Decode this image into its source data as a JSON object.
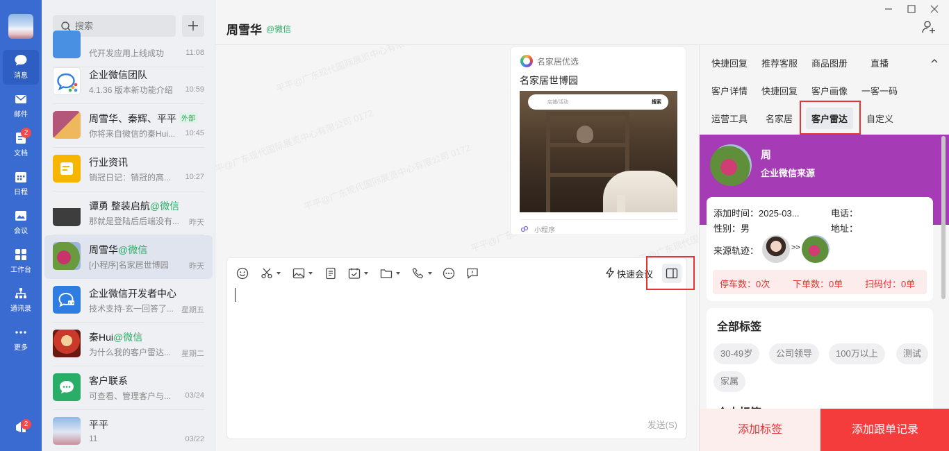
{
  "nav": {
    "items": [
      {
        "label": "消息",
        "icon": "chat-bubble-icon"
      },
      {
        "label": "邮件",
        "icon": "mail-icon"
      },
      {
        "label": "文档",
        "icon": "document-icon",
        "badge": "2"
      },
      {
        "label": "日程",
        "icon": "calendar-icon"
      },
      {
        "label": "会议",
        "icon": "meeting-icon"
      },
      {
        "label": "工作台",
        "icon": "grid-icon"
      },
      {
        "label": "通讯录",
        "icon": "contacts-icon"
      },
      {
        "label": "更多",
        "icon": "more-icon"
      }
    ],
    "bottom_badge": "2"
  },
  "search": {
    "placeholder": "搜索"
  },
  "conversations": [
    {
      "name": "",
      "snippet": "代开发应用上线成功",
      "time": "11:08"
    },
    {
      "name": "企业微信团队",
      "snippet": "4.1.36 版本新功能介绍",
      "time": "10:59"
    },
    {
      "name": "周雪华、秦辉、平平",
      "tag": "外部",
      "snippet": "你将来自微信的秦Hui...",
      "time": "10:45"
    },
    {
      "name": "行业资讯",
      "snippet": "销冠日记：销冠的高...",
      "time": "10:27"
    },
    {
      "name": "谭勇 整装启航",
      "wx": "@微信",
      "snippet": "那就是登陆后后端没有...",
      "time": "昨天"
    },
    {
      "name": "周雪华",
      "wx": "@微信",
      "snippet": "[小程序]名家居世博园",
      "time": "昨天"
    },
    {
      "name": "企业微信开发者中心",
      "snippet": "技术支持-玄一回答了...",
      "time": "星期五"
    },
    {
      "name": "秦Hui",
      "wx": "@微信",
      "snippet": "为什么我的客户雷达...",
      "time": "星期二"
    },
    {
      "name": "客户联系",
      "snippet": "可查看、管理客户与...",
      "time": "03/24"
    },
    {
      "name": "平平",
      "snippet": "11",
      "time": "03/22"
    }
  ],
  "chat": {
    "title": "周雪华",
    "title_suffix": "@微信"
  },
  "watermark": "平平@广东现代国际展览中心有限公司 0172",
  "card": {
    "brand": "名家居优选",
    "title": "名家居世博园",
    "search_placeholder": "店铺/活动",
    "search_button": "搜索",
    "footer": "小程序"
  },
  "composer": {
    "quick_meeting": "快速会议",
    "send": "发送(S)"
  },
  "right_panel": {
    "tabs_row1": [
      "快捷回复",
      "推荐客服",
      "商品图册",
      "直播"
    ],
    "tabs_row2": [
      "客户详情",
      "快捷回复",
      "客户画像",
      "一客一码"
    ],
    "tabs_row3": [
      "运营工具",
      "名家居",
      "客户雷达",
      "自定义"
    ],
    "profile": {
      "name": "周",
      "source": "企业微信来源"
    },
    "info": {
      "add_time": "添加时间：2025-03...",
      "phone": "电话：",
      "gender": "性别：男",
      "address": "地址：",
      "trail_label": "来源轨迹：",
      "trail_arrow": ">>"
    },
    "stats": {
      "parking": "停车数：0次",
      "orders": "下单数：0单",
      "scan_pay": "扫码付：0单"
    },
    "tags": {
      "title": "全部标签",
      "items": [
        "30-49岁",
        "公司领导",
        "100万以上",
        "测试",
        "家属"
      ],
      "next_title": "个人标签"
    },
    "buttons": {
      "add_tag": "添加标签",
      "add_record": "添加跟单记录"
    }
  },
  "colors": {
    "nav": "#3a6bd1",
    "accent_red": "#e53232",
    "profile_bg": "#a53cb5",
    "wechat_green": "#2aae67"
  }
}
